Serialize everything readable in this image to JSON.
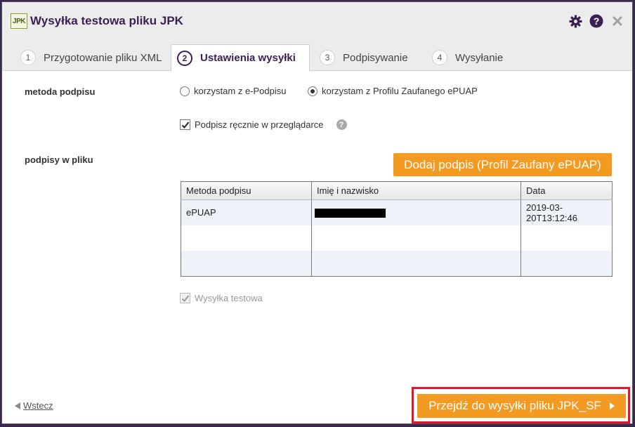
{
  "dialog": {
    "logo_text": "JPK",
    "title": "Wysyłka testowa pliku JPK"
  },
  "tabs": [
    {
      "num": "1",
      "label": "Przygotowanie pliku XML",
      "active": false
    },
    {
      "num": "2",
      "label": "Ustawienia wysyłki",
      "active": true
    },
    {
      "num": "3",
      "label": "Podpisywanie",
      "active": false
    },
    {
      "num": "4",
      "label": "Wysyłanie",
      "active": false
    }
  ],
  "signature_method": {
    "label": "metoda podpisu",
    "options": [
      {
        "label": "korzystam z e-Podpisu",
        "checked": false
      },
      {
        "label": "korzystam z Profilu Zaufanego ePUAP",
        "checked": true
      }
    ],
    "manual_sign": {
      "label": "Podpisz ręcznie w przeglądarce",
      "checked": true,
      "help": "?"
    }
  },
  "signatures": {
    "label": "podpisy w pliku",
    "add_button": "Dodaj podpis (Profil Zaufany ePUAP)",
    "columns": [
      "Metoda podpisu",
      "Imię i nazwisko",
      "Data"
    ],
    "rows": [
      {
        "method": "ePUAP",
        "name_redacted": true,
        "date": "2019-03-20T13:12:46"
      }
    ]
  },
  "test_send": {
    "label": "Wysyłka testowa",
    "checked": true,
    "disabled": true
  },
  "footer": {
    "back_label": "Wstecz",
    "next_label": "Przejdź do wysyłki pliku JPK_SF"
  },
  "colors": {
    "accent_orange": "#f39a23",
    "title_purple": "#3b1f52",
    "highlight_red": "#e0162a"
  }
}
